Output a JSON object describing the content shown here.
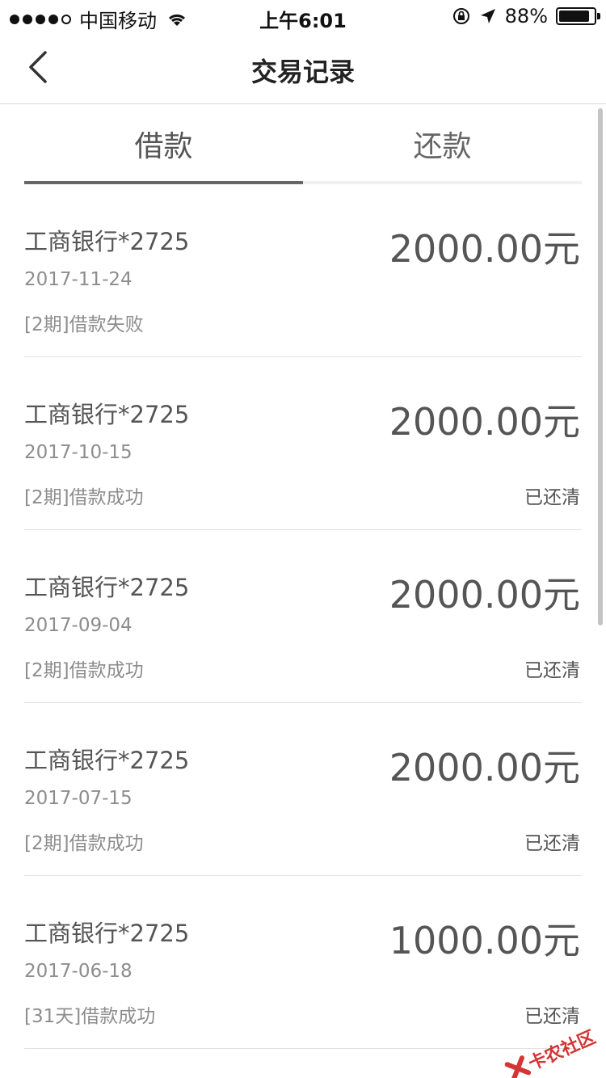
{
  "status_bar": {
    "carrier": "中国移动",
    "time": "上午6:01",
    "battery": "88%"
  },
  "nav": {
    "title": "交易记录"
  },
  "tabs": [
    {
      "label": "借款",
      "active": true
    },
    {
      "label": "还款",
      "active": false
    }
  ],
  "records": [
    {
      "bank": "工商银行*2725",
      "date": "2017-11-24",
      "desc": "[2期]借款失败",
      "amount": "2000.00元",
      "status": ""
    },
    {
      "bank": "工商银行*2725",
      "date": "2017-10-15",
      "desc": "[2期]借款成功",
      "amount": "2000.00元",
      "status": "已还清"
    },
    {
      "bank": "工商银行*2725",
      "date": "2017-09-04",
      "desc": "[2期]借款成功",
      "amount": "2000.00元",
      "status": "已还清"
    },
    {
      "bank": "工商银行*2725",
      "date": "2017-07-15",
      "desc": "[2期]借款成功",
      "amount": "2000.00元",
      "status": "已还清"
    },
    {
      "bank": "工商银行*2725",
      "date": "2017-06-18",
      "desc": "[31天]借款成功",
      "amount": "1000.00元",
      "status": "已还清"
    }
  ],
  "watermark": {
    "text": "卡农社区"
  },
  "colors": {
    "text_primary": "#555555",
    "text_secondary": "#8d8d8d",
    "divider": "#e2e2e2",
    "watermark": "#d02020"
  }
}
